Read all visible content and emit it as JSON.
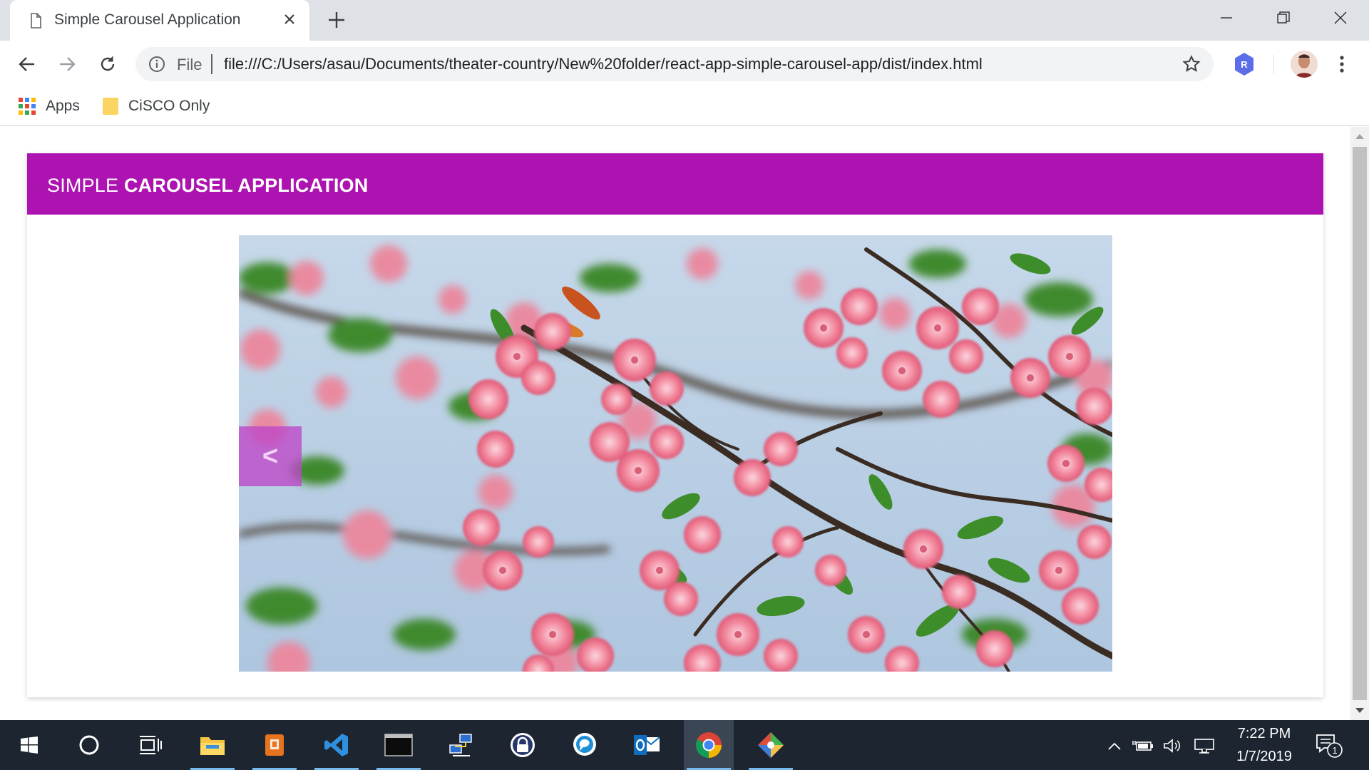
{
  "browser": {
    "tab_title": "Simple Carousel Application",
    "omnibox_scheme_label": "File",
    "url": "file:///C:/Users/asau/Documents/theater-country/New%20folder/react-app-simple-carousel-app/dist/index.html",
    "extension_badge": "R",
    "bookmarks": [
      {
        "label": "Apps",
        "icon": "apps-grid-icon"
      },
      {
        "label": "CiSCO Only",
        "icon": "folder-icon"
      }
    ]
  },
  "page": {
    "header_title_light": "SIMPLE ",
    "header_title_bold": "CAROUSEL APPLICATION",
    "carousel": {
      "prev_label": "<",
      "image_subject": "pink-blossoms-on-branches"
    }
  },
  "colors": {
    "header_bg": "#ac13b0",
    "prev_button_bg": "#be46c8",
    "taskbar_bg": "#1c2530",
    "tab_strip_bg": "#dee1e6"
  },
  "taskbar": {
    "apps": [
      "windows-start-icon",
      "cortana-search-icon",
      "task-view-icon",
      "file-explorer-icon",
      "powerpoint-like-icon",
      "vscode-icon",
      "terminal-icon",
      "network-icon",
      "keepass-lock-icon",
      "chat-client-icon",
      "outlook-icon",
      "chrome-icon",
      "git-tool-icon"
    ],
    "time": "7:22 PM",
    "date": "1/7/2019",
    "notification_count": "1"
  }
}
